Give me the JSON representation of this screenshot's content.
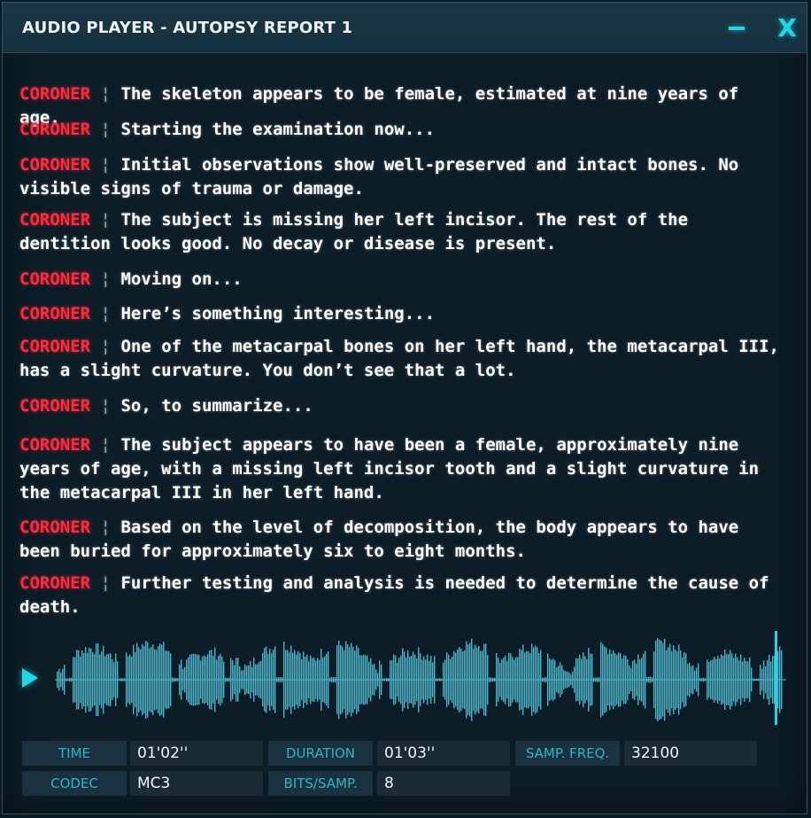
{
  "window": {
    "title": "AUDIO PLAYER - AUTOPSY REPORT 1",
    "minimize_icon": "minimize-icon",
    "close_label": "X"
  },
  "transcript": [
    {
      "speaker": "CORONER",
      "text": "The skeleton appears to be female, estimated at nine years of age."
    },
    {
      "speaker": "CORONER",
      "text": "Starting the examination now..."
    },
    {
      "speaker": "CORONER",
      "text": "Initial observations show well-preserved and intact bones. No visible signs of trauma or damage."
    },
    {
      "speaker": "CORONER",
      "text": "The subject is missing her left incisor. The rest of the dentition looks good. No decay or disease is present."
    },
    {
      "speaker": "CORONER",
      "text": "Moving on..."
    },
    {
      "speaker": "CORONER",
      "text": "Here’s something interesting..."
    },
    {
      "speaker": "CORONER",
      "text": "One of the metacarpal bones on her left hand, the metacarpal III, has a slight curvature. You don’t see that a lot."
    },
    {
      "speaker": "CORONER",
      "text": "So, to summarize..."
    },
    {
      "speaker": "CORONER",
      "text": "The subject appears to have been a female, approximately nine years of age, with a missing left incisor tooth and a slight curvature in the metacarpal III in her left hand."
    },
    {
      "speaker": "CORONER",
      "text": "Based on the level of decomposition, the body appears to have been buried for approximately six to eight months."
    },
    {
      "speaker": "CORONER",
      "text": "Further testing and analysis is needed to determine the cause of death."
    }
  ],
  "separator": "¦",
  "player": {
    "play_icon": "play-icon",
    "progress_fraction": 0.984,
    "waveform_color": "#4fb3c8",
    "playhead_color": "#1fd6e8"
  },
  "info": {
    "time_label": "TIME",
    "time_value": "01'02''",
    "duration_label": "DURATION",
    "duration_value": "01'03''",
    "freq_label": "SAMP. FREQ.",
    "freq_value": "32100",
    "codec_label": "CODEC",
    "codec_value": "MC3",
    "bits_label": "BITS/SAMP.",
    "bits_value": "8"
  },
  "colors": {
    "speaker": "#ff2a3a",
    "accent": "#1fd6e8",
    "label_text": "#2bb6c8"
  }
}
